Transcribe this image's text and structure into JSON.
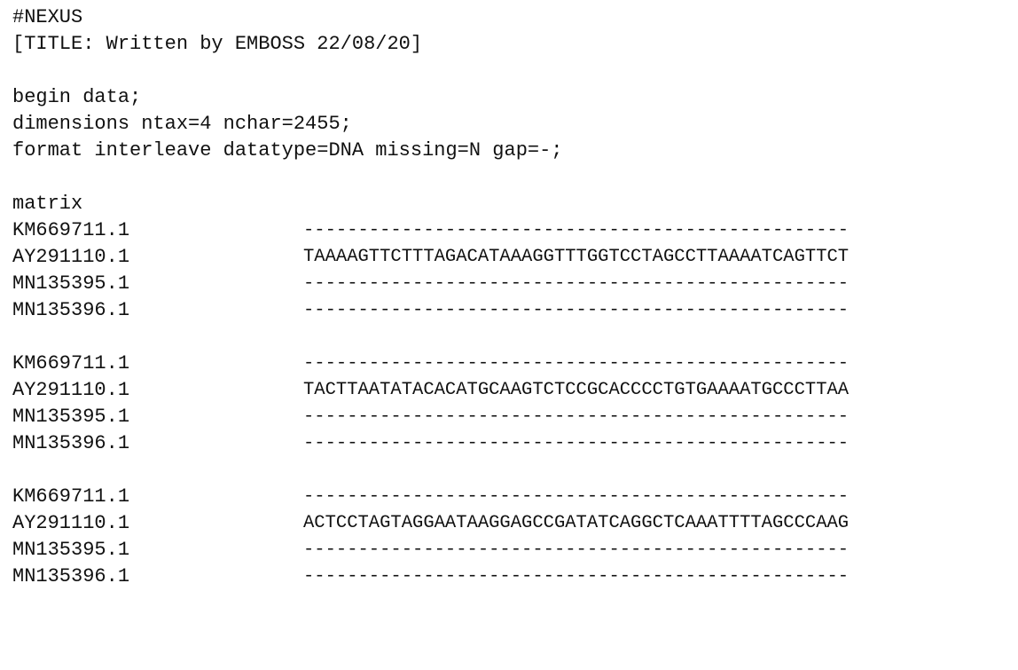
{
  "header": {
    "line1": "#NEXUS",
    "line2": "[TITLE: Written by EMBOSS 22/08/20]"
  },
  "data_block": {
    "begin": "begin data;",
    "dimensions": "dimensions ntax=4 nchar=2455;",
    "format": "format interleave datatype=DNA missing=N gap=-;"
  },
  "matrix": {
    "keyword": "matrix",
    "blocks": [
      {
        "rows": [
          {
            "taxon": "KM669711.1",
            "seq": "--------------------------------------------------"
          },
          {
            "taxon": "AY291110.1",
            "seq": "TAAAAGTTCTTTAGACATAAAGGTTTGGTCCTAGCCTTAAAATCAGTTCT"
          },
          {
            "taxon": "MN135395.1",
            "seq": "--------------------------------------------------"
          },
          {
            "taxon": "MN135396.1",
            "seq": "--------------------------------------------------"
          }
        ]
      },
      {
        "rows": [
          {
            "taxon": "KM669711.1",
            "seq": "--------------------------------------------------"
          },
          {
            "taxon": "AY291110.1",
            "seq": "TACTTAATATACACATGCAAGTCTCCGCACCCCTGTGAAAATGCCCTTAA"
          },
          {
            "taxon": "MN135395.1",
            "seq": "--------------------------------------------------"
          },
          {
            "taxon": "MN135396.1",
            "seq": "--------------------------------------------------"
          }
        ]
      },
      {
        "rows": [
          {
            "taxon": "KM669711.1",
            "seq": "--------------------------------------------------"
          },
          {
            "taxon": "AY291110.1",
            "seq": "ACTCCTAGTAGGAATAAGGAGCCGATATCAGGCTCAAATTTTAGCCCAAG"
          },
          {
            "taxon": "MN135395.1",
            "seq": "--------------------------------------------------"
          },
          {
            "taxon": "MN135396.1",
            "seq": "--------------------------------------------------"
          }
        ]
      }
    ]
  }
}
